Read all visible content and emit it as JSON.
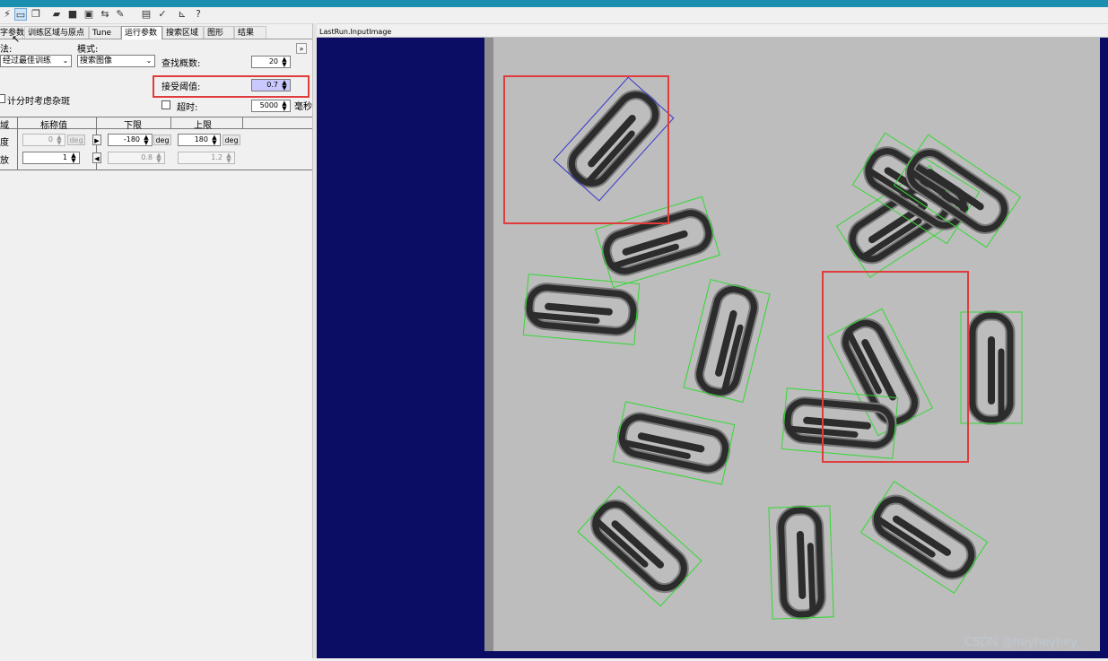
{
  "toolbar": {
    "icons": [
      "wand-icon",
      "train-icon",
      "copy-icon",
      "open-folder-icon",
      "save-icon",
      "save-as-icon",
      "run-icon",
      "brush-icon",
      "image-icon",
      "check-icon",
      "ruler-icon",
      "help-icon"
    ]
  },
  "tabs": [
    "字参数",
    "训练区域与原点",
    "Tune",
    "运行参数",
    "搜索区域",
    "图形",
    "结果"
  ],
  "params": {
    "algorithm_label": "法:",
    "algorithm_value": "经过最佳训练",
    "mode_label": "模式:",
    "mode_value": "搜索图像",
    "find_count_label": "查找概数:",
    "find_count_value": "20",
    "accept_label": "接受阈值:",
    "accept_value": "0.7",
    "timeout_label": "超时:",
    "timeout_value": "5000",
    "timeout_unit": "毫秒",
    "clutter_label": "计分时考虑杂斑"
  },
  "dof": {
    "headers": [
      "域",
      "标称值",
      "下限",
      "上限"
    ],
    "rows": [
      {
        "name": "度",
        "nominal": "0",
        "unit": "deg",
        "low": "-180",
        "high": "180"
      },
      {
        "name": "放",
        "nominal": "1",
        "unit": "",
        "low": "0.8",
        "high": "1.2"
      }
    ]
  },
  "viewer": {
    "title": "LastRun.InputImage"
  },
  "watermark": "CSDN @heyheyhey_",
  "colors": {
    "titlebar": "#1b8fb0",
    "image_border": "#0b0c63",
    "detect_box": "#33dd33",
    "selected_box": "#3333cc",
    "highlight_box": "#e03c3c",
    "accept_highlight": "#c9c9ff"
  }
}
